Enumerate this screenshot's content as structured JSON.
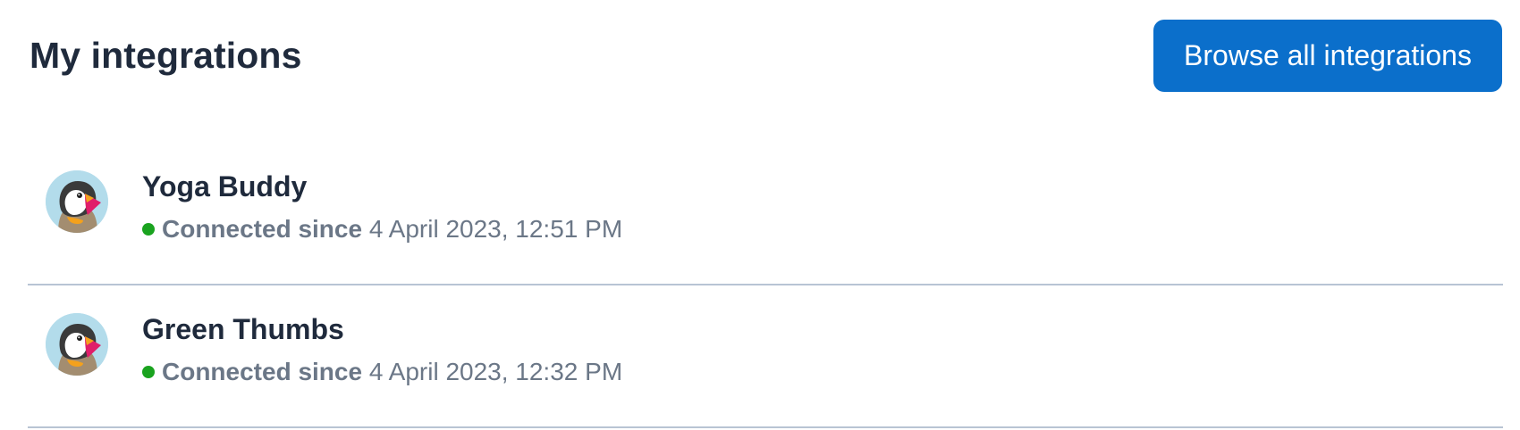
{
  "header": {
    "title": "My integrations",
    "browse_label": "Browse all integrations",
    "browse_color": "#0b6fcb"
  },
  "integrations": [
    {
      "name": "Yoga Buddy",
      "status_label": "Connected since",
      "connected_at": "4 April 2023, 12:51 PM",
      "status_color": "#1aa31f",
      "icon": "puffin-logo-icon"
    },
    {
      "name": "Green Thumbs",
      "status_label": "Connected since",
      "connected_at": "4 April 2023, 12:32 PM",
      "status_color": "#1aa31f",
      "icon": "puffin-logo-icon"
    }
  ]
}
